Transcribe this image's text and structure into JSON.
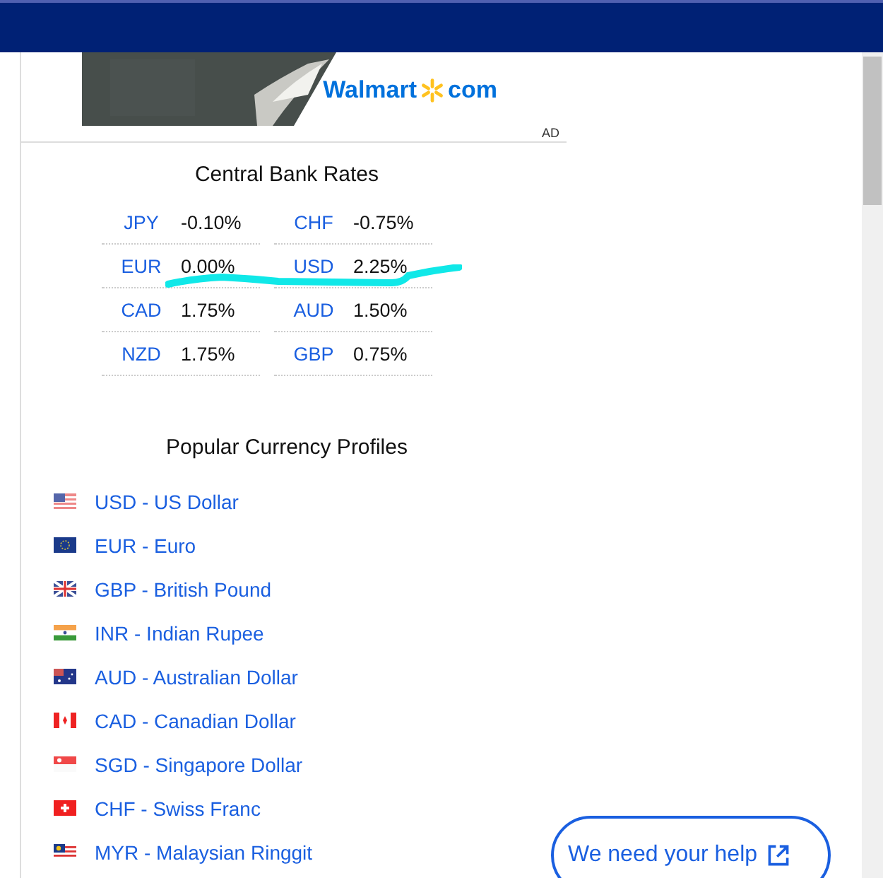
{
  "ad": {
    "brand": "Walmart",
    "domain": "com",
    "label": "AD"
  },
  "rates": {
    "title": "Central Bank Rates",
    "rows": [
      [
        {
          "code": "JPY",
          "rate": "-0.10%"
        },
        {
          "code": "CHF",
          "rate": "-0.75%"
        }
      ],
      [
        {
          "code": "EUR",
          "rate": "0.00%"
        },
        {
          "code": "USD",
          "rate": "2.25%"
        }
      ],
      [
        {
          "code": "CAD",
          "rate": "1.75%"
        },
        {
          "code": "AUD",
          "rate": "1.50%"
        }
      ],
      [
        {
          "code": "NZD",
          "rate": "1.75%"
        },
        {
          "code": "GBP",
          "rate": "0.75%"
        }
      ]
    ]
  },
  "profiles": {
    "title": "Popular Currency Profiles",
    "items": [
      {
        "label": "USD - US Dollar",
        "kind": "us"
      },
      {
        "label": "EUR - Euro",
        "kind": "eu"
      },
      {
        "label": "GBP - British Pound",
        "kind": "gb"
      },
      {
        "label": "INR - Indian Rupee",
        "kind": "in"
      },
      {
        "label": "AUD - Australian Dollar",
        "kind": "au"
      },
      {
        "label": "CAD - Canadian Dollar",
        "kind": "ca"
      },
      {
        "label": "SGD - Singapore Dollar",
        "kind": "sg"
      },
      {
        "label": "CHF - Swiss Franc",
        "kind": "ch"
      },
      {
        "label": "MYR - Malaysian Ringgit",
        "kind": "my"
      }
    ]
  },
  "help_button": {
    "label": "We need your help"
  }
}
